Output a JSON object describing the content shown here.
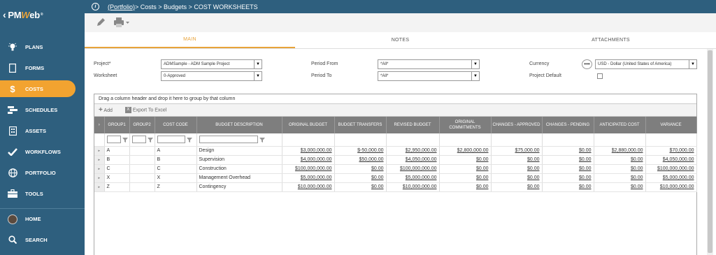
{
  "app": {
    "logo_pre": "PM",
    "logo_w": "W",
    "logo_post": "eb",
    "logo_reg": "®"
  },
  "sidebar": {
    "items": [
      {
        "label": "PLANS",
        "icon": "lightbulb-icon"
      },
      {
        "label": "FORMS",
        "icon": "document-icon"
      },
      {
        "label": "COSTS",
        "icon": "dollar-icon",
        "active": true
      },
      {
        "label": "SCHEDULES",
        "icon": "schedule-icon"
      },
      {
        "label": "ASSETS",
        "icon": "building-icon"
      },
      {
        "label": "WORKFLOWS",
        "icon": "checkmark-icon"
      },
      {
        "label": "PORTFOLIO",
        "icon": "globe-icon"
      },
      {
        "label": "TOOLS",
        "icon": "toolbox-icon"
      },
      {
        "label": "HOME",
        "icon": "avatar"
      },
      {
        "label": "SEARCH",
        "icon": "search-icon"
      }
    ]
  },
  "breadcrumb": {
    "portfolio": "(Portfolio)",
    "rest": " > Costs > Budgets > COST WORKSHEETS"
  },
  "tabs": [
    "MAIN",
    "NOTES",
    "ATTACHMENTS"
  ],
  "form": {
    "project_label": "Project*",
    "project_value": "ADMSample - ADM Sample Project",
    "worksheet_label": "Worksheet",
    "worksheet_value": "0-Approved",
    "period_from_label": "Period From",
    "period_from_value": "*All*",
    "period_to_label": "Period To",
    "period_to_value": "*All*",
    "currency_label": "Currency",
    "currency_value": "USD - Dollar (United States of America)",
    "project_default_label": "Project Default"
  },
  "grid": {
    "drag_hint": "Drag a column header and drop it here to group by that column",
    "add_label": "Add",
    "export_label": "Export To Excel",
    "columns": [
      "GROUP1",
      "GROUP2",
      "COST CODE",
      "BUDGET DESCRIPTION",
      "ORIGINAL BUDGET",
      "BUDGET TRANSFERS",
      "REVISED BUDGET",
      "ORIGINAL COMMITMENTS",
      "CHANGES - APPROVED",
      "CHANGES - PENDING",
      "ANTICIPATED COST",
      "VARIANCE"
    ],
    "rows": [
      [
        "A",
        "",
        "A",
        "Design",
        "$3,000,000.00",
        "$-50,000.00",
        "$2,950,000.00",
        "$2,800,000.00",
        "$75,000.00",
        "$0.00",
        "$2,880,000.00",
        "$70,000.00"
      ],
      [
        "B",
        "",
        "B",
        "Supervision",
        "$4,000,000.00",
        "$50,000.00",
        "$4,050,000.00",
        "$0.00",
        "$0.00",
        "$0.00",
        "$0.00",
        "$4,050,000.00"
      ],
      [
        "C",
        "",
        "C",
        "Construction",
        "$100,000,000.00",
        "$0.00",
        "$100,000,000.00",
        "$0.00",
        "$0.00",
        "$0.00",
        "$0.00",
        "$100,000,000.00"
      ],
      [
        "X",
        "",
        "X",
        "Management Overhead",
        "$5,000,000.00",
        "$0.00",
        "$5,000,000.00",
        "$0.00",
        "$0.00",
        "$0.00",
        "$0.00",
        "$5,000,000.00"
      ],
      [
        "Z",
        "",
        "Z",
        "Contingency",
        "$10,000,000.00",
        "$0.00",
        "$10,000,000.00",
        "$0.00",
        "$0.00",
        "$0.00",
        "$0.00",
        "$10,000,000.00"
      ]
    ]
  },
  "colors": {
    "sidebar": "#2e5f7e",
    "accent": "#f2a330",
    "header": "#7e7e7e"
  }
}
